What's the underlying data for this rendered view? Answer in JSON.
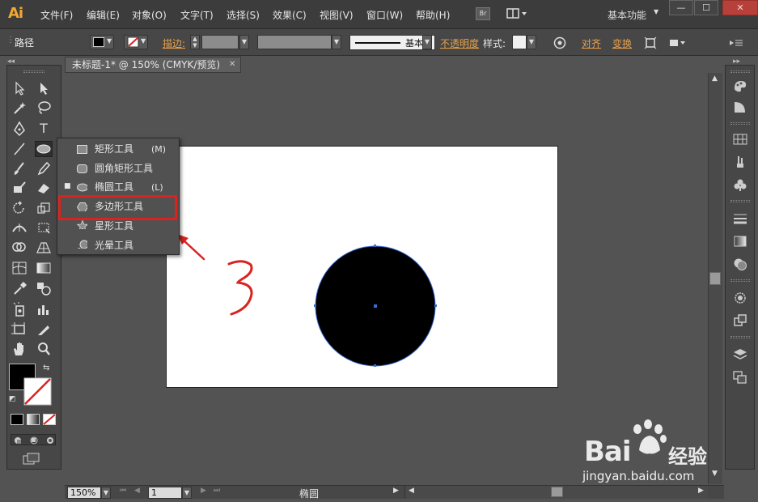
{
  "app": {
    "logo": "Ai",
    "menu": [
      "文件(F)",
      "编辑(E)",
      "对象(O)",
      "文字(T)",
      "选择(S)",
      "效果(C)",
      "视图(V)",
      "窗口(W)",
      "帮助(H)"
    ],
    "bridge_label": "Br",
    "workspace": "基本功能",
    "window_buttons": [
      "—",
      "☐",
      "✕"
    ]
  },
  "control": {
    "object_type": "路径",
    "stroke_label": "描边:",
    "stroke_profile": "基本",
    "opacity_label": "不透明度",
    "style_label": "样式:",
    "align_label": "对齐",
    "transform_label": "变换"
  },
  "document": {
    "tab_title": "未标题-1* @ 150% (CMYK/预览)",
    "tab_close": "✕"
  },
  "flyout": {
    "items": [
      {
        "label": "矩形工具",
        "key": "(M)",
        "icon": "rectangle-icon",
        "current": false
      },
      {
        "label": "圆角矩形工具",
        "key": "",
        "icon": "rounded-rectangle-icon",
        "current": false
      },
      {
        "label": "椭圆工具",
        "key": "(L)",
        "icon": "ellipse-icon",
        "current": true
      },
      {
        "label": "多边形工具",
        "key": "",
        "icon": "polygon-icon",
        "current": false
      },
      {
        "label": "星形工具",
        "key": "",
        "icon": "star-icon",
        "current": false
      },
      {
        "label": "光晕工具",
        "key": "",
        "icon": "flare-icon",
        "current": false
      }
    ],
    "highlighted": "多边形工具"
  },
  "annotation": {
    "number": "3",
    "color": "#d9231f"
  },
  "canvas": {
    "shape_fill": "#000000",
    "selection_color": "#3a6bd9"
  },
  "status": {
    "zoom": "150%",
    "artboard": "1",
    "tool_name": "椭圆"
  },
  "watermark": {
    "brand": "Bai",
    "brand_suffix": "经验",
    "url": "jingyan.baidu.com"
  }
}
